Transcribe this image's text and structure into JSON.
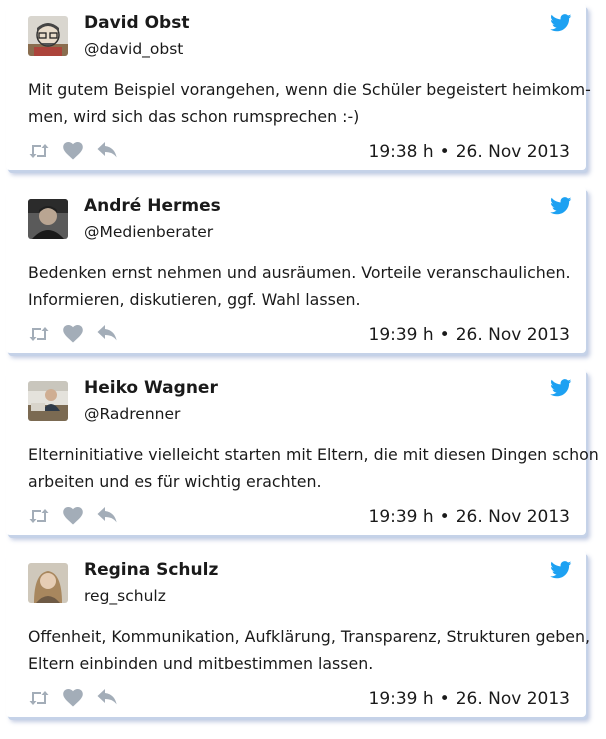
{
  "accent_color": "#1da1f2",
  "icon_color": "#9aa6b2",
  "tweets": [
    {
      "name": "David Obst",
      "handle": "@david_obst",
      "lines": [
        "Mit gutem Beispiel vorangehen, wenn die Schüler begeistert heimkom-",
        "men, wird sich das schon rumsprechen :-)"
      ],
      "time": "19:38 h",
      "separator": "•",
      "date": "26. Nov 2013"
    },
    {
      "name": "André Hermes",
      "handle": "@Medienberater",
      "lines": [
        "Bedenken ernst nehmen und ausräumen. Vorteile veranschaulichen.",
        "Informieren, diskutieren, ggf. Wahl lassen."
      ],
      "time": "19:39 h",
      "separator": "•",
      "date": "26. Nov 2013"
    },
    {
      "name": "Heiko Wagner",
      "handle": "@Radrenner",
      "lines": [
        "Elterninitiative vielleicht starten mit Eltern, die mit diesen Dingen schon",
        "arbeiten und es für wichtig erachten."
      ],
      "time": "19:39 h",
      "separator": "•",
      "date": "26. Nov 2013"
    },
    {
      "name": "Regina Schulz",
      "handle": "reg_schulz",
      "lines": [
        "Offenheit, Kommunikation, Aufklärung, Transparenz, Strukturen geben,",
        "Eltern einbinden und mitbestimmen lassen."
      ],
      "time": "19:39 h",
      "separator": "•",
      "date": "26. Nov 2013"
    }
  ],
  "icons": {
    "retweet": "retweet-icon",
    "like": "heart-icon",
    "reply": "reply-icon",
    "brand": "twitter-bird-icon"
  }
}
